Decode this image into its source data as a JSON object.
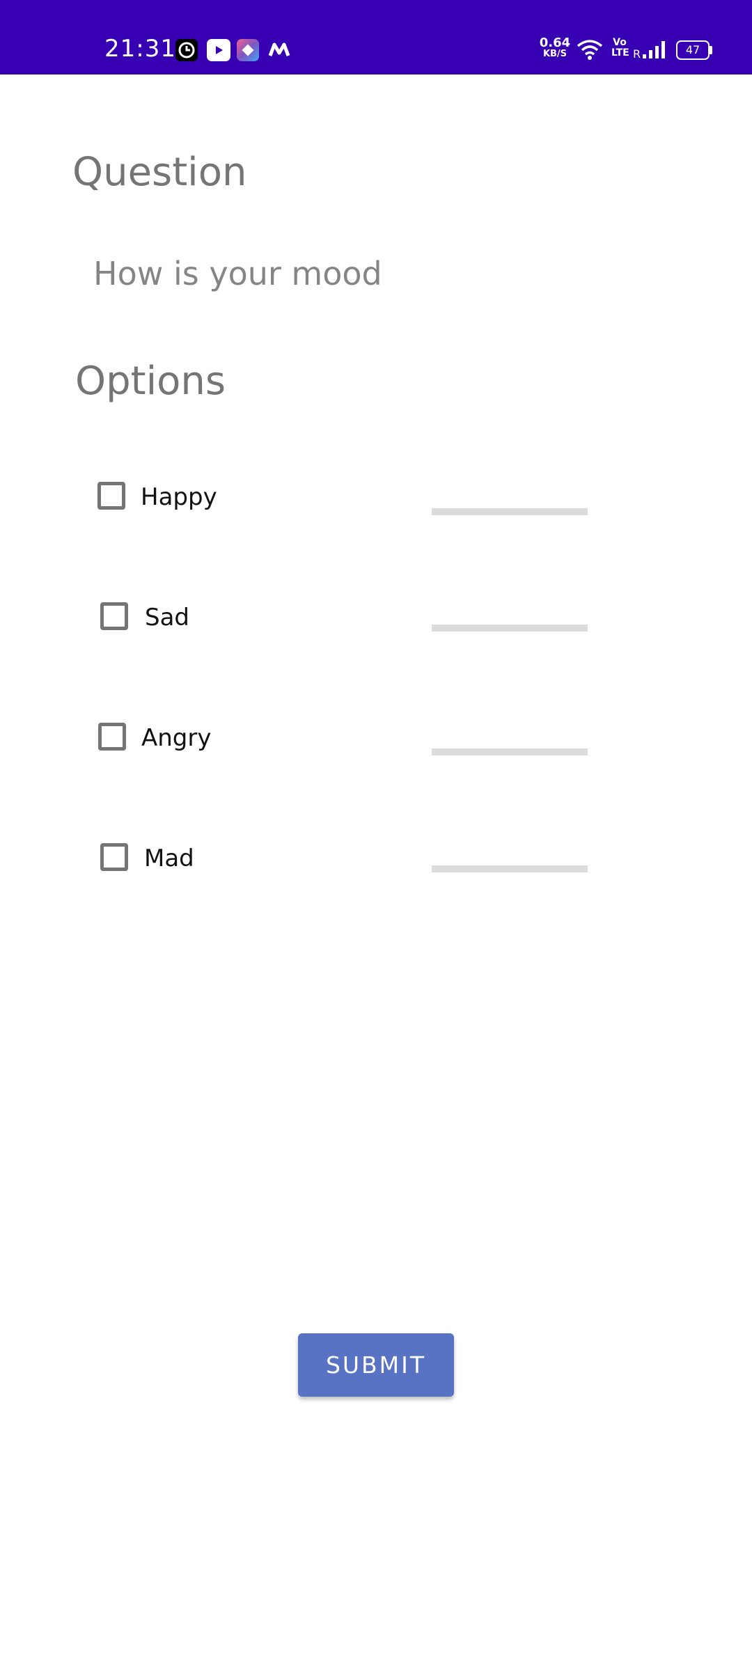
{
  "status_bar": {
    "time": "21:31",
    "network_speed_value": "0.64",
    "network_speed_unit": "KB/S",
    "volte_top": "Vo",
    "volte_bottom": "LTE",
    "roaming": "R",
    "battery": "47",
    "background_color": "#3700b3",
    "notification_icons": [
      "clock-app-icon",
      "youtube-icon",
      "shortcut-app-icon",
      "m-app-icon"
    ]
  },
  "question": {
    "heading": "Question",
    "text": "How is your mood"
  },
  "options": {
    "heading": "Options",
    "items": [
      {
        "label": "Happy",
        "checked": false
      },
      {
        "label": "Sad",
        "checked": false
      },
      {
        "label": "Angry",
        "checked": false
      },
      {
        "label": "Mad",
        "checked": false
      }
    ]
  },
  "submit": {
    "label": "SUBMIT",
    "color": "#5872c4"
  }
}
